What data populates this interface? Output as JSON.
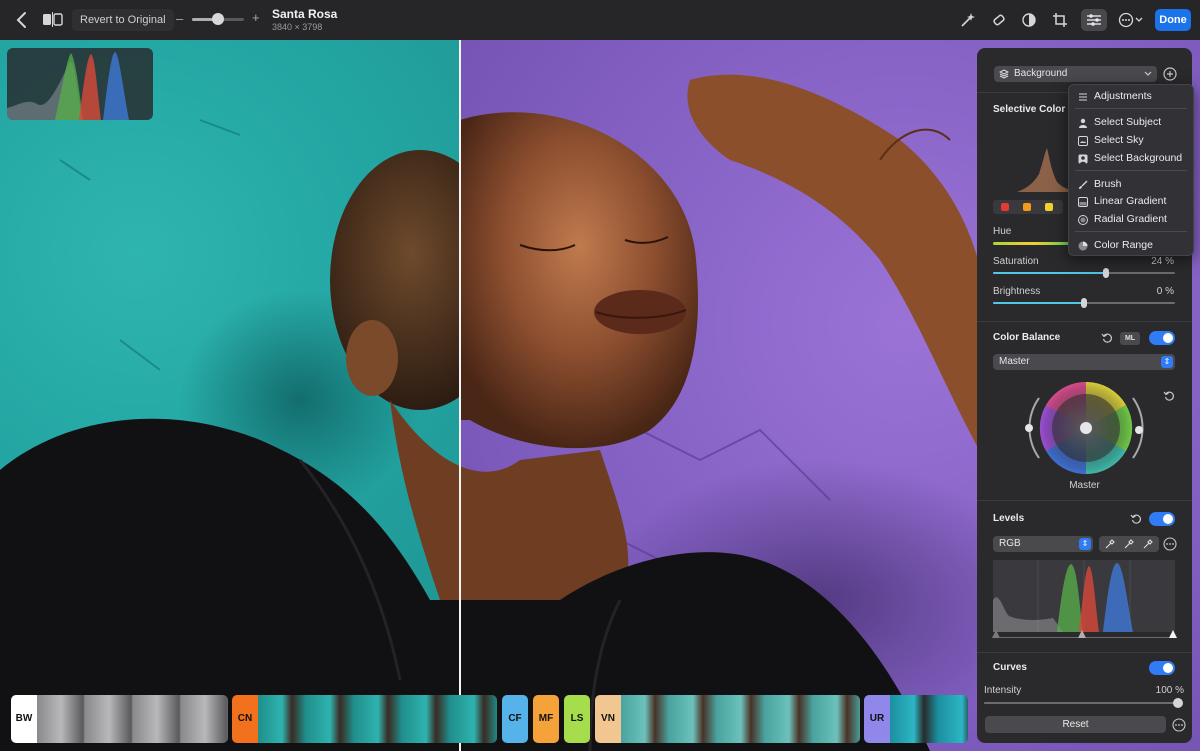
{
  "toolbar": {
    "revert_label": "Revert to Original",
    "zoom_minus": "–",
    "zoom_plus": "+",
    "zoom_fraction": 0.5,
    "title": "Santa Rosa",
    "subtitle": "3840 × 3798",
    "done_label": "Done",
    "icons": [
      "ml-magic-icon",
      "retouch-eraser-icon",
      "sphere-layers-icon",
      "crop-icon",
      "adjust-sliders-icon",
      "more-options-icon"
    ]
  },
  "panel": {
    "layer_select": "Background",
    "selective_color": {
      "title": "Selective Color",
      "swatches": [
        "#e53935",
        "#f59b1a",
        "#f2d12c"
      ],
      "hue_label": "Hue",
      "saturation_label": "Saturation",
      "saturation_value": "24 %",
      "saturation_fraction": 0.62,
      "brightness_label": "Brightness",
      "brightness_value": "0 %",
      "brightness_fraction": 0.5
    },
    "color_balance": {
      "title": "Color Balance",
      "ml_label": "ML",
      "mode_select": "Master",
      "wheel_label": "Master"
    },
    "levels": {
      "title": "Levels",
      "channel_select": "RGB"
    },
    "curves": {
      "title": "Curves",
      "intensity_label": "Intensity",
      "intensity_value": "100 %",
      "intensity_fraction": 1.0
    },
    "reset_label": "Reset"
  },
  "menu": {
    "items": [
      {
        "label": "Adjustments",
        "icon": "sliders-icon"
      },
      {
        "label": "Select Subject",
        "icon": "person-icon"
      },
      {
        "label": "Select Sky",
        "icon": "sky-icon"
      },
      {
        "label": "Select Background",
        "icon": "background-person-icon"
      },
      {
        "label": "Brush",
        "icon": "brush-icon"
      },
      {
        "label": "Linear Gradient",
        "icon": "linear-gradient-icon"
      },
      {
        "label": "Radial Gradient",
        "icon": "radial-gradient-icon"
      },
      {
        "label": "Color Range",
        "icon": "color-range-icon"
      }
    ]
  },
  "filmstrip": {
    "groups": [
      {
        "label": "BW",
        "color": "#ffffff",
        "text_color": "#111111"
      },
      {
        "label": "CN",
        "color": "#f2711c",
        "text_color": "#111111"
      },
      {
        "label": "CF",
        "color": "#55b3ea",
        "text_color": "#111111"
      },
      {
        "label": "MF",
        "color": "#f6a23a",
        "text_color": "#111111"
      },
      {
        "label": "LS",
        "color": "#a6dd4c",
        "text_color": "#111111"
      },
      {
        "label": "VN",
        "color": "#f1c690",
        "text_color": "#111111"
      },
      {
        "label": "UR",
        "color": "#8f88ea",
        "text_color": "#111111"
      }
    ]
  }
}
